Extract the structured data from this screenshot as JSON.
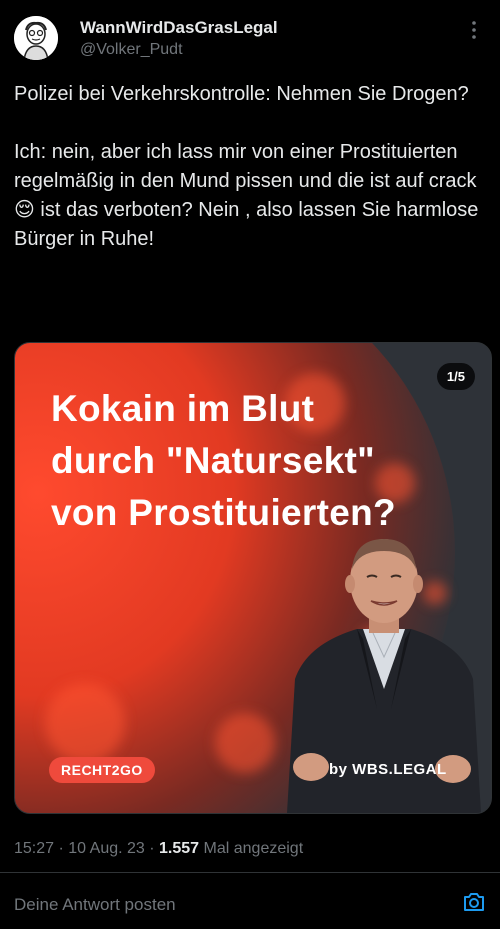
{
  "tweet": {
    "display_name": "WannWirdDasGrasLegal",
    "handle": "@Volker_Pudt",
    "text_line1": "Polizei bei Verkehrskontrolle: Nehmen Sie Drogen?",
    "text_line2": "Ich: nein, aber ich lass mir von einer Prostituierten regelmäßig in den Mund pissen und die ist auf crack😌 ist das verboten? Nein , also lassen Sie harmlose Bürger in Ruhe!"
  },
  "media": {
    "counter": "1/5",
    "headline": [
      "Kokain im Blut",
      "durch \"Natursekt\"",
      "von Prostituierten?"
    ],
    "badge": "RECHT2GO",
    "byline": "by WBS.LEGAL"
  },
  "meta": {
    "time": "15:27",
    "date": "10 Aug. 23",
    "views": "1.557",
    "views_label": "Mal angezeigt"
  },
  "reply": {
    "placeholder": "Deine Antwort posten"
  },
  "icons": {
    "more": "more-options-icon",
    "camera": "camera-icon"
  },
  "colors": {
    "accent": "#1d9bf0",
    "badge": "#ef4a3c",
    "muted": "#71767b"
  }
}
